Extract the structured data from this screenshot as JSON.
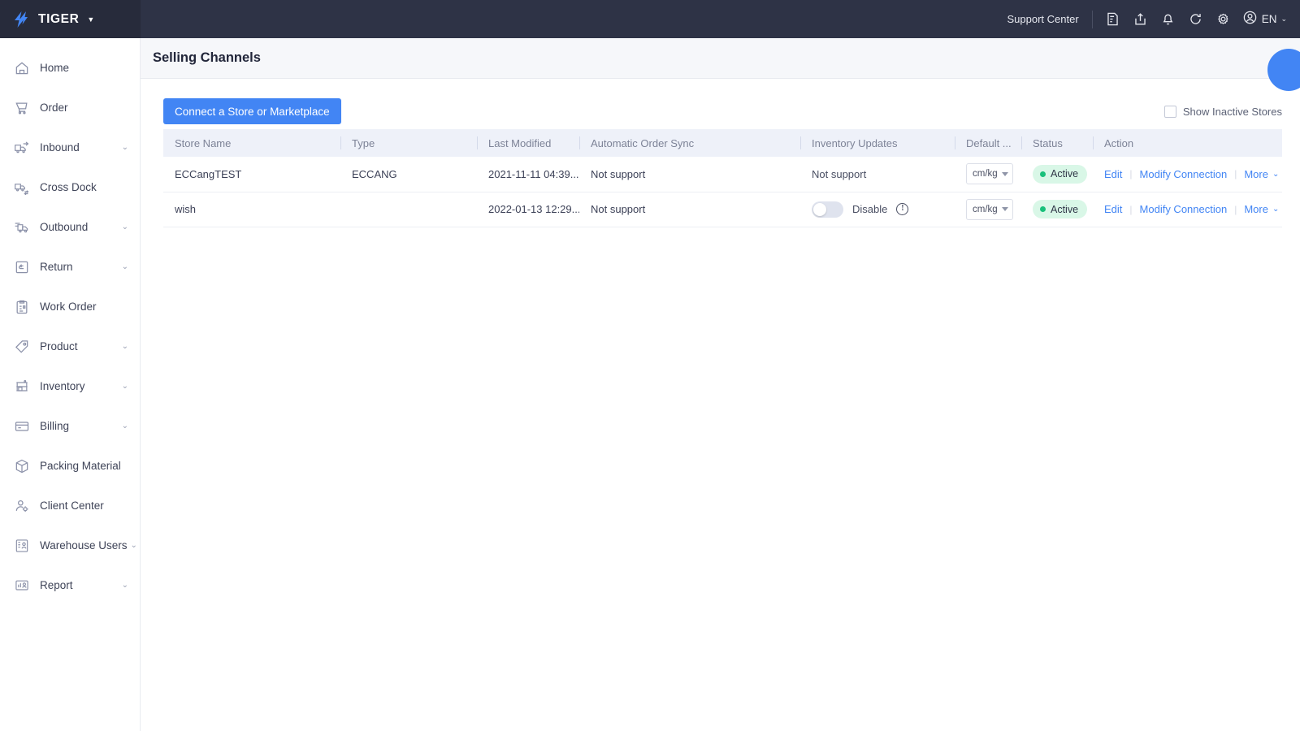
{
  "topbar": {
    "brand_name": "TIGER",
    "brand_caret": "▼",
    "support_label": "Support Center",
    "icons": [
      {
        "name": "document-edit-icon"
      },
      {
        "name": "share-export-icon"
      },
      {
        "name": "bell-notification-icon"
      },
      {
        "name": "refresh-icon"
      },
      {
        "name": "gear-settings-icon"
      }
    ],
    "user_language": "EN",
    "user_caret": "⌄"
  },
  "sidebar": {
    "items": [
      {
        "label": "Home",
        "icon": "home-icon",
        "expandable": false,
        "caret": ""
      },
      {
        "label": "Order",
        "icon": "cart-icon",
        "expandable": false,
        "caret": ""
      },
      {
        "label": "Inbound",
        "icon": "truck-inbound-icon",
        "expandable": true,
        "caret": "⌄"
      },
      {
        "label": "Cross Dock",
        "icon": "truck-crossdock-icon",
        "expandable": false,
        "caret": ""
      },
      {
        "label": "Outbound",
        "icon": "truck-outbound-icon",
        "expandable": true,
        "caret": "⌄"
      },
      {
        "label": "Return",
        "icon": "return-box-icon",
        "expandable": true,
        "caret": "⌄"
      },
      {
        "label": "Work Order",
        "icon": "clipboard-icon",
        "expandable": false,
        "caret": ""
      },
      {
        "label": "Product",
        "icon": "tag-icon",
        "expandable": true,
        "caret": "⌄"
      },
      {
        "label": "Inventory",
        "icon": "inventory-shelf-icon",
        "expandable": true,
        "caret": "⌄"
      },
      {
        "label": "Billing",
        "icon": "credit-card-icon",
        "expandable": true,
        "caret": "⌄"
      },
      {
        "label": "Packing Material",
        "icon": "package-box-icon",
        "expandable": false,
        "caret": ""
      },
      {
        "label": "Client Center",
        "icon": "user-gear-icon",
        "expandable": false,
        "caret": ""
      },
      {
        "label": "Warehouse Users",
        "icon": "user-list-icon",
        "expandable": true,
        "caret": "⌄"
      },
      {
        "label": "Report",
        "icon": "report-chart-icon",
        "expandable": true,
        "caret": "⌄"
      }
    ]
  },
  "page": {
    "title": "Selling Channels"
  },
  "toolbar": {
    "connect_button": "Connect a Store or Marketplace",
    "show_inactive_label": "Show Inactive Stores",
    "show_inactive_checked": false
  },
  "table": {
    "columns": [
      "Store Name",
      "Type",
      "Last Modified",
      "Automatic Order Sync",
      "Inventory Updates",
      "Default ...",
      "Status",
      "Action"
    ],
    "rows": [
      {
        "store_name": "ECCangTEST",
        "type": "ECCANG",
        "last_modified": "2021-11-11 04:39...",
        "order_sync": "Not support",
        "inventory_mode": "text",
        "inventory_text": "Not support",
        "inventory_toggle_label": "",
        "default_unit": "cm/kg",
        "status": "Active",
        "actions": [
          "Edit",
          "Modify Connection",
          "More"
        ],
        "more_caret": "⌄"
      },
      {
        "store_name": "wish",
        "type": "",
        "last_modified": "2022-01-13 12:29...",
        "order_sync": "Not support",
        "inventory_mode": "toggle",
        "inventory_text": "",
        "inventory_toggle_label": "Disable",
        "default_unit": "cm/kg",
        "status": "Active",
        "actions": [
          "Edit",
          "Modify Connection",
          "More"
        ],
        "more_caret": "⌄"
      }
    ]
  },
  "colors": {
    "accent": "#4285f4",
    "topbar_bg": "#2e3346",
    "status_green": "#18c07a",
    "status_pill_bg": "#d9f7e7",
    "table_header_bg": "#eef1f9"
  }
}
